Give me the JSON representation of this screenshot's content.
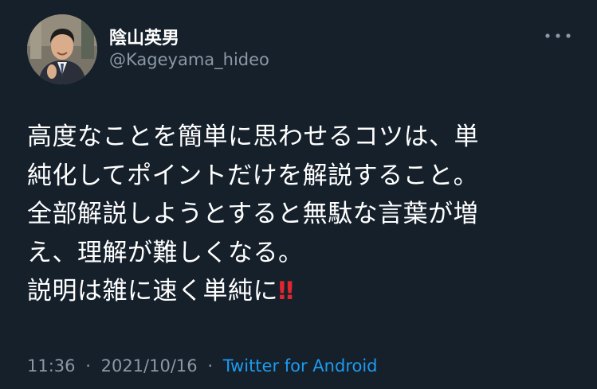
{
  "author": {
    "name": "陰山英男",
    "handle": "@Kageyama_hideo"
  },
  "tweet": {
    "body": "高度なことを簡単に思わせるコツは、単\n純化してポイントだけを解説すること。\n全部解説しようとすると無駄な言葉が増\nえ、理解が難しくなる。\n説明は雑に速く単純に",
    "emoji": "‼",
    "time": "11:36",
    "date": "2021/10/16",
    "separator": "·",
    "source": "Twitter for Android"
  },
  "icons": {
    "more": "more-options-icon",
    "emoji": "double-exclamation-icon"
  },
  "colors": {
    "background": "#15202b",
    "text": "#ffffff",
    "secondary": "#8b98a5",
    "link": "#1d9bf0",
    "emoji": "#e0272f"
  }
}
